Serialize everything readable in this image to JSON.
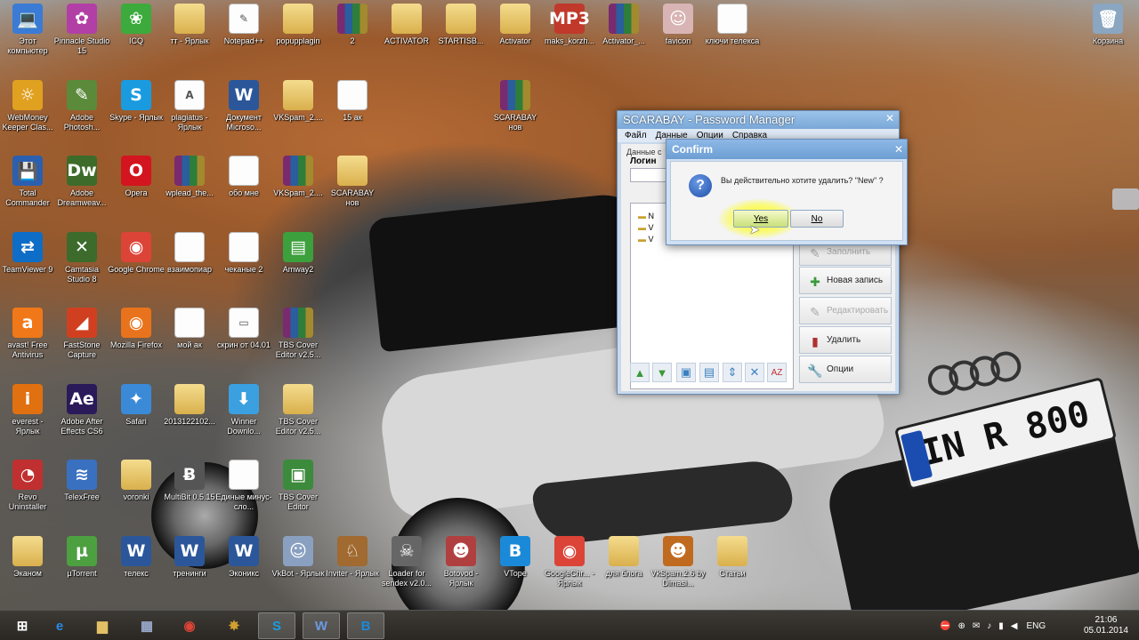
{
  "desktop": {
    "icons": [
      {
        "label": "Этот компьютер",
        "glyph": "💻",
        "kind": "app",
        "color": "#3a7bd5"
      },
      {
        "label": "Pinnacle Studio 15",
        "glyph": "✿",
        "kind": "app",
        "color": "#b23fa5"
      },
      {
        "label": "ICQ",
        "glyph": "❀",
        "kind": "app",
        "color": "#3caa3c"
      },
      {
        "label": "тт - Ярлык",
        "glyph": "",
        "kind": "folder",
        "color": "#e2c066"
      },
      {
        "label": "Notepad++",
        "glyph": "✎",
        "kind": "doc",
        "color": "#ffffff"
      },
      {
        "label": "popupplagin",
        "glyph": "",
        "kind": "folder",
        "color": "#e2c066"
      },
      {
        "label": "2",
        "glyph": "",
        "kind": "rar",
        "color": "#7a2a6e"
      },
      {
        "label": "ACTIVATOR",
        "glyph": "",
        "kind": "folder",
        "color": "#e2c066"
      },
      {
        "label": "STARTISB...",
        "glyph": "",
        "kind": "folder",
        "color": "#e2c066"
      },
      {
        "label": "Activator",
        "glyph": "",
        "kind": "folder",
        "color": "#e2c066"
      },
      {
        "label": "maks_korzh...",
        "glyph": "MP3",
        "kind": "app",
        "color": "#c0392b"
      },
      {
        "label": "Activator_...",
        "glyph": "",
        "kind": "rar",
        "color": "#7a2a6e"
      },
      {
        "label": "favicon",
        "glyph": "☺",
        "kind": "app",
        "color": "#d8b4b4"
      },
      {
        "label": "ключи телекса",
        "glyph": "",
        "kind": "doc",
        "color": "#ffffff"
      },
      {
        "label": "Корзина",
        "glyph": "🗑",
        "kind": "app",
        "color": "#8aa6c0"
      },
      {
        "label": "WebMoney Keeper Clas...",
        "glyph": "☼",
        "kind": "app",
        "color": "#e0a020"
      },
      {
        "label": "Adobe Photosh...",
        "glyph": "✎",
        "kind": "app",
        "color": "#5a8a3a"
      },
      {
        "label": "Skype - Ярлык",
        "glyph": "S",
        "kind": "app",
        "color": "#1a9be0"
      },
      {
        "label": "plagiatus - Ярлык",
        "glyph": "A",
        "kind": "doc",
        "color": "#ffffff"
      },
      {
        "label": "Документ Microso...",
        "glyph": "W",
        "kind": "app",
        "color": "#2b579a"
      },
      {
        "label": "VKSpam_2....",
        "glyph": "",
        "kind": "folder",
        "color": "#e2c066"
      },
      {
        "label": "15 ак",
        "glyph": "",
        "kind": "doc",
        "color": "#ffffff"
      },
      {
        "label": "SCARABAY нов",
        "glyph": "",
        "kind": "rar",
        "color": "#7a2a6e"
      },
      {
        "label": "Total Commander",
        "glyph": "💾",
        "kind": "app",
        "color": "#2b5fb0"
      },
      {
        "label": "Adobe Dreamweav...",
        "glyph": "Dw",
        "kind": "app",
        "color": "#3d6b2a"
      },
      {
        "label": "Opera",
        "glyph": "O",
        "kind": "app",
        "color": "#d3151f"
      },
      {
        "label": "wplead_the...",
        "glyph": "",
        "kind": "rar",
        "color": "#7a2a6e"
      },
      {
        "label": "обо мне",
        "glyph": "",
        "kind": "doc",
        "color": "#ffffff"
      },
      {
        "label": "VKSpam_2....",
        "glyph": "",
        "kind": "rar",
        "color": "#7a2a6e"
      },
      {
        "label": "SCARABAY нов",
        "glyph": "",
        "kind": "folder",
        "color": "#e2c066"
      },
      {
        "label": "TeamViewer 9",
        "glyph": "⇄",
        "kind": "app",
        "color": "#0e6dc6"
      },
      {
        "label": "Camtasia Studio 8",
        "glyph": "✕",
        "kind": "app",
        "color": "#3c6b2c"
      },
      {
        "label": "Google Chrome",
        "glyph": "◉",
        "kind": "app",
        "color": "#db4437"
      },
      {
        "label": "взаимопиар",
        "glyph": "",
        "kind": "doc",
        "color": "#ffffff"
      },
      {
        "label": "чеканые 2",
        "glyph": "",
        "kind": "doc",
        "color": "#ffffff"
      },
      {
        "label": "Amway2",
        "glyph": "▤",
        "kind": "app",
        "color": "#3ca03c"
      },
      {
        "label": "avast! Free Antivirus",
        "glyph": "a",
        "kind": "app",
        "color": "#f07818"
      },
      {
        "label": "FastStone Capture",
        "glyph": "◢",
        "kind": "app",
        "color": "#d04020"
      },
      {
        "label": "Mozilla Firefox",
        "glyph": "◉",
        "kind": "app",
        "color": "#e8731c"
      },
      {
        "label": "мой ак",
        "glyph": "",
        "kind": "doc",
        "color": "#ffffff"
      },
      {
        "label": "скрин от 04.01",
        "glyph": "▭",
        "kind": "doc",
        "color": "#ffffff"
      },
      {
        "label": "TBS Cover Editor v2.5...",
        "glyph": "",
        "kind": "rar",
        "color": "#7a2a6e"
      },
      {
        "label": "everest - Ярлык",
        "glyph": "i",
        "kind": "app",
        "color": "#e07010"
      },
      {
        "label": "Adobe After Effects CS6",
        "glyph": "Ae",
        "kind": "app",
        "color": "#2a1a5a"
      },
      {
        "label": "Safari",
        "glyph": "✦",
        "kind": "app",
        "color": "#3a8ad8"
      },
      {
        "label": "2013122102...",
        "glyph": "",
        "kind": "folder",
        "color": "#e2c066"
      },
      {
        "label": "Winner Downlo...",
        "glyph": "⬇",
        "kind": "app",
        "color": "#3aa0e0"
      },
      {
        "label": "TBS Cover Editor v2.5...",
        "glyph": "",
        "kind": "folder",
        "color": "#e2c066"
      },
      {
        "label": "Revo Uninstaller",
        "glyph": "◔",
        "kind": "app",
        "color": "#c03030"
      },
      {
        "label": "TelexFree",
        "glyph": "≋",
        "kind": "app",
        "color": "#3a70c0"
      },
      {
        "label": "voronki",
        "glyph": "",
        "kind": "folder",
        "color": "#e2c066"
      },
      {
        "label": "MultiBit 0.5.15",
        "glyph": "Ƀ",
        "kind": "app",
        "color": "#555555"
      },
      {
        "label": "Единые минус-сло...",
        "glyph": "",
        "kind": "doc",
        "color": "#ffffff"
      },
      {
        "label": "TBS Cover Editor",
        "glyph": "▣",
        "kind": "app",
        "color": "#3c8a3c"
      },
      {
        "label": "Эканом",
        "glyph": "",
        "kind": "folder",
        "color": "#e2c066"
      },
      {
        "label": "µTorrent",
        "glyph": "µ",
        "kind": "app",
        "color": "#4ca040"
      },
      {
        "label": "телекс",
        "glyph": "W",
        "kind": "app",
        "color": "#2b579a"
      },
      {
        "label": "тренинги",
        "glyph": "W",
        "kind": "app",
        "color": "#2b579a"
      },
      {
        "label": "Эконикс",
        "glyph": "W",
        "kind": "app",
        "color": "#2b579a"
      },
      {
        "label": "VkBot - Ярлык",
        "glyph": "☺",
        "kind": "app",
        "color": "#8aa0c0"
      },
      {
        "label": "Inviter - Ярлык",
        "glyph": "♘",
        "kind": "app",
        "color": "#a06a30"
      },
      {
        "label": "Loader for sendex v2.0...",
        "glyph": "☠",
        "kind": "app",
        "color": "#666666"
      },
      {
        "label": "Botovod - Ярлык",
        "glyph": "☻",
        "kind": "app",
        "color": "#b04040"
      },
      {
        "label": "VTope",
        "glyph": "B",
        "kind": "app",
        "color": "#1a8ad8"
      },
      {
        "label": "GoogleChr... - Ярлык",
        "glyph": "◉",
        "kind": "app",
        "color": "#db4437"
      },
      {
        "label": "для блога",
        "glyph": "",
        "kind": "folder",
        "color": "#e2c066"
      },
      {
        "label": "VkSpam.2.6 by Dimasi...",
        "glyph": "☻",
        "kind": "app",
        "color": "#c06a20"
      },
      {
        "label": "Статьи",
        "glyph": "",
        "kind": "folder",
        "color": "#e2c066"
      }
    ],
    "plate_text": "IN R 800"
  },
  "password_manager": {
    "title": "SCARABAY - Password Manager",
    "menu": [
      "Файл",
      "Данные",
      "Опции",
      "Справка"
    ],
    "tab_label": "Данные с",
    "login_label": "Логин",
    "tree_items": [
      "N",
      "V",
      "V"
    ],
    "buttons": {
      "fill": "Заполнить",
      "new": "Новая запись",
      "edit": "Редактировать",
      "delete": "Удалить",
      "options": "Опции"
    }
  },
  "confirm": {
    "title": "Confirm",
    "message": "Вы действительно хотите удалить? \"New\" ?",
    "yes": "Yes",
    "no": "No"
  },
  "taskbar": {
    "lang": "ENG",
    "time": "21:06",
    "date": "05.01.2014"
  }
}
